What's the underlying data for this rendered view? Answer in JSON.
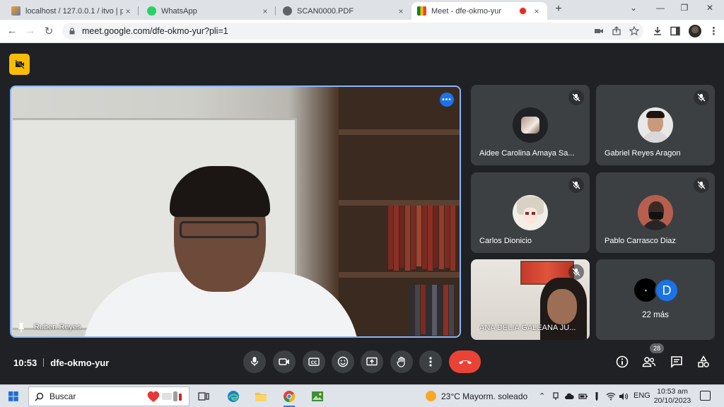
{
  "browser": {
    "tabs": [
      {
        "title": "localhost / 127.0.0.1 / itvo | php",
        "close": "×"
      },
      {
        "title": "WhatsApp",
        "close": "×"
      },
      {
        "title": "SCAN0000.PDF",
        "close": "×"
      },
      {
        "title": "Meet - dfe-okmo-yur",
        "close": "×",
        "recording": true
      }
    ],
    "new_tab": "+",
    "window_controls": {
      "dropdown": "⌄",
      "minimize": "—",
      "restore": "❐",
      "close": "✕"
    },
    "nav": {
      "back": "←",
      "forward": "→",
      "reload": "↻"
    },
    "url": "meet.google.com/dfe-okmo-yur?pli=1",
    "colors": {
      "tabstrip": "#dee1e6",
      "accent": "#1a73e8"
    }
  },
  "meet": {
    "main": {
      "name": "Ruben Reyes",
      "more": "•••"
    },
    "tiles": [
      {
        "name": "Aidee Carolina Amaya Sa...",
        "muted": true
      },
      {
        "name": "Gabriel Reyes Aragon",
        "muted": true
      },
      {
        "name": "Carlos Dionicio",
        "muted": true
      },
      {
        "name": "Pablo Carrasco Diaz",
        "muted": true
      },
      {
        "name": "ANA DELIA GALEANA JU...",
        "muted": true
      }
    ],
    "more_tile": {
      "avatar_letter": "D",
      "count_label": "22 más"
    },
    "bottom": {
      "time": "10:53",
      "meeting_code": "dfe-okmo-yur",
      "participants_count": "28"
    },
    "colors": {
      "main_border": "#8ab4f8",
      "end_call": "#ea4335",
      "tile_bg": "#3c4043",
      "badge": "#fbbc04"
    }
  },
  "taskbar": {
    "search_placeholder": "Buscar",
    "weather": "23°C  Mayorm. soleado",
    "language": "ENG",
    "clock_time": "10:53 am",
    "clock_date": "20/10/2023"
  }
}
